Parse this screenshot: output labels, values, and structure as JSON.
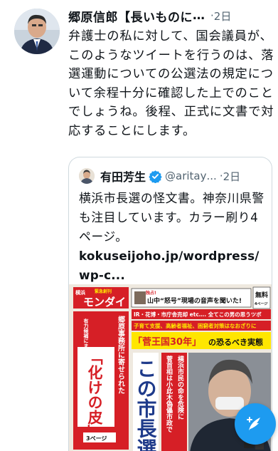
{
  "tweet": {
    "author_name": "郷原信郎【長いものに",
    "author_ellipsis": "…",
    "dot": "·",
    "time": "2日",
    "text": "弁護士の私に対して、国会議員が、このようなツイートを行うのは、落選運動についての公選法の規定について余程十分に確認した上でのことでしょうね。後程、正式に文書で対応することにします。"
  },
  "quote": {
    "author_name": "有田芳生",
    "handle": "@aritay",
    "handle_ellipsis": "...",
    "dot": "·",
    "time": "2日",
    "text": "横浜市長選の怪文書。神奈川県警も注目しています。カラー刷り4ページ。",
    "link_line1": "kokuseijoho.jp/wordpress/",
    "link_line2": "wp-c..."
  },
  "flyer": {
    "badge_small": "横浜",
    "badge_top": "緊急創刊",
    "masthead": "モンダイ",
    "exclusive": "独占!",
    "headline_top": "山中“怒号”現場の音声を聞いた!",
    "corner_label": "無料",
    "corner_sub": "4ページ",
    "red_line": "IR・花博・市庁舎売却 etc…. 全てこの男の思うツボ",
    "red_line2": "子育て支援、高齢者福祉、困窮者対策はなおざりに",
    "yellow_headline_a": "「菅王国30年」",
    "yellow_headline_b": "の恐るべき実態",
    "left_sub": "有力候補にまつわる数々の",
    "left_main": "「化けの皮」",
    "left_col2": "郷原事務所に寄せられた",
    "page_ref": "3ページ",
    "center_big": "この市長選",
    "side_col1": "菅首相は小此木偽儡市政で",
    "side_col2": "横浜市民の命を危険に"
  },
  "colors": {
    "accent_blue": "#1d9bf0",
    "text": "#0f1419",
    "muted": "#536471",
    "border": "#cfd9de",
    "flyer_red": "#d61f26",
    "flyer_yellow": "#ffe600"
  },
  "icons": {
    "verified": "verified-badge-icon",
    "compose": "compose-tweet-icon"
  }
}
